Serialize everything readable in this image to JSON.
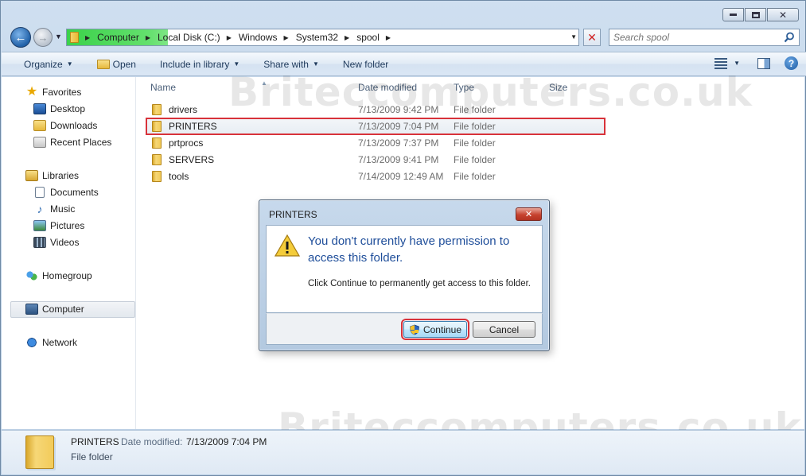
{
  "navigation": {
    "back_icon": "back-arrow-icon",
    "forward_icon": "forward-arrow-icon",
    "breadcrumbs": [
      "Computer",
      "Local Disk (C:)",
      "Windows",
      "System32",
      "spool"
    ],
    "search_placeholder": "Search spool"
  },
  "toolbar": {
    "organize": "Organize",
    "open": "Open",
    "include_in_library": "Include in library",
    "share_with": "Share with",
    "new_folder": "New folder"
  },
  "sidebar": {
    "favorites": {
      "label": "Favorites",
      "items": [
        "Desktop",
        "Downloads",
        "Recent Places"
      ]
    },
    "libraries": {
      "label": "Libraries",
      "items": [
        "Documents",
        "Music",
        "Pictures",
        "Videos"
      ]
    },
    "homegroup": "Homegroup",
    "computer": "Computer",
    "network": "Network"
  },
  "file_list": {
    "columns": [
      "Name",
      "Date modified",
      "Type",
      "Size"
    ],
    "rows": [
      {
        "name": "drivers",
        "date": "7/13/2009 9:42 PM",
        "type": "File folder"
      },
      {
        "name": "PRINTERS",
        "date": "7/13/2009 7:04 PM",
        "type": "File folder"
      },
      {
        "name": "prtprocs",
        "date": "7/13/2009 7:37 PM",
        "type": "File folder"
      },
      {
        "name": "SERVERS",
        "date": "7/13/2009 9:41 PM",
        "type": "File folder"
      },
      {
        "name": "tools",
        "date": "7/14/2009 12:49 AM",
        "type": "File folder"
      }
    ],
    "highlight_color": "#d8323a"
  },
  "dialog": {
    "title": "PRINTERS",
    "main_instruction": "You don't currently have permission to access this folder.",
    "content": "Click Continue to permanently get access to this folder.",
    "continue_label": "Continue",
    "cancel_label": "Cancel"
  },
  "details": {
    "name": "PRINTERS",
    "date_label": "Date modified:",
    "date_value": "7/13/2009 7:04 PM",
    "type": "File folder"
  },
  "watermark": "Briteccomputers.co.uk"
}
